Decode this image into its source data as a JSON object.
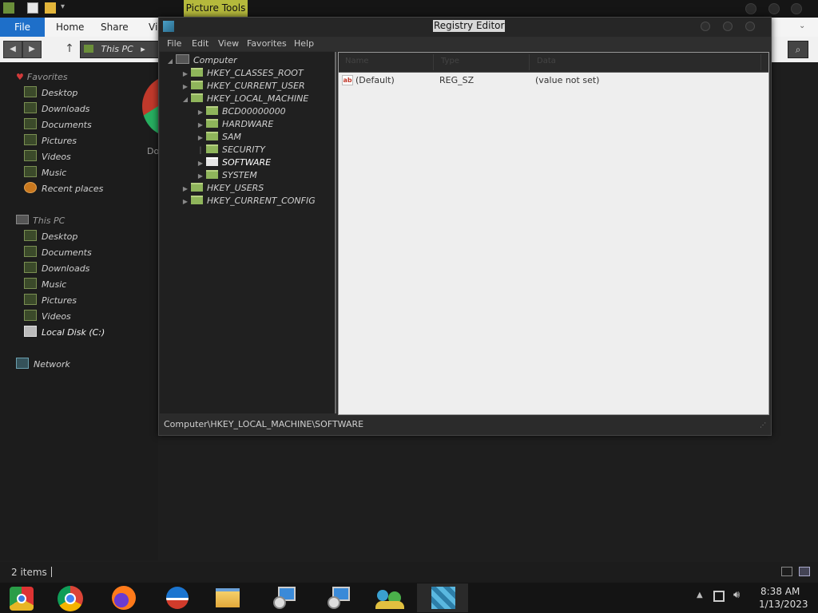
{
  "explorer": {
    "ribbon_context_tab": "Picture Tools",
    "tabs": [
      "File",
      "Home",
      "Share",
      "Vi"
    ],
    "address_crumb": "This PC",
    "nav": {
      "favorites_header": "Favorites",
      "favorites": [
        "Desktop",
        "Downloads",
        "Documents",
        "Pictures",
        "Videos",
        "Music",
        "Recent places"
      ],
      "thispc_header": "This PC",
      "thispc": [
        "Desktop",
        "Documents",
        "Downloads",
        "Music",
        "Pictures",
        "Videos",
        "Local Disk (C:)"
      ],
      "network": "Network"
    },
    "partial_label": "Do",
    "status_items": "2 items"
  },
  "regedit": {
    "title": "Registry Editor",
    "menu": [
      "File",
      "Edit",
      "View",
      "Favorites",
      "Help"
    ],
    "tree": {
      "root": "Computer",
      "hives": [
        "HKEY_CLASSES_ROOT",
        "HKEY_CURRENT_USER",
        "HKEY_LOCAL_MACHINE"
      ],
      "hklm_children": [
        "BCD00000000",
        "HARDWARE",
        "SAM",
        "SECURITY",
        "SOFTWARE",
        "SYSTEM"
      ],
      "hives_after": [
        "HKEY_USERS",
        "HKEY_CURRENT_CONFIG"
      ],
      "selected": "SOFTWARE"
    },
    "columns": [
      "Name",
      "Type",
      "Data"
    ],
    "values": [
      {
        "name": "(Default)",
        "type": "REG_SZ",
        "data": "(value not set)"
      }
    ],
    "status_path": "Computer\\HKEY_LOCAL_MACHINE\\SOFTWARE"
  },
  "taskbar": {
    "apps": [
      "chrome-old",
      "chrome",
      "firefox",
      "opera",
      "file-explorer",
      "network-setup",
      "network-setup-2",
      "users",
      "registry-editor"
    ],
    "time": "8:38 AM",
    "date": "1/13/2023"
  },
  "colors": {
    "accent_file_tab": "#1e6fc9",
    "picture_tools": "#b5b93c",
    "folder": "#8fb55b",
    "favorites_heart": "#d23a3a"
  }
}
